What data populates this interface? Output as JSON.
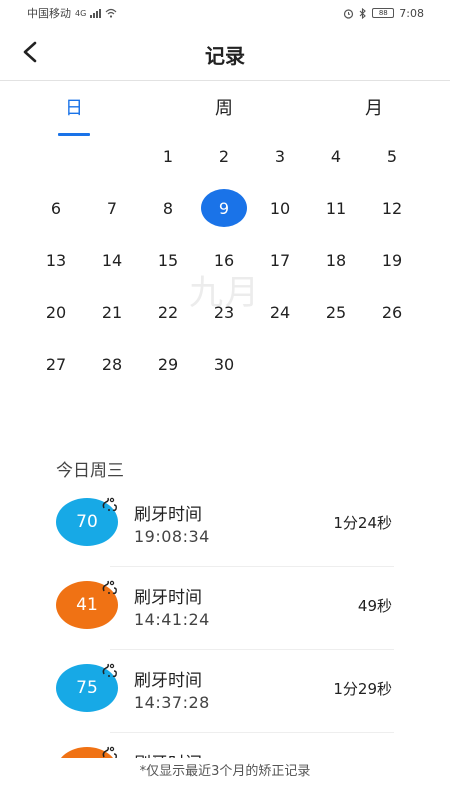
{
  "status_bar": {
    "carrier": "中国移动",
    "network": "4G",
    "battery": "88",
    "time": "7:08",
    "icons": [
      "signal-icon",
      "wifi-icon",
      "alarm-icon",
      "bluetooth-icon",
      "battery-icon"
    ]
  },
  "header": {
    "title": "记录",
    "back_icon": "chevron-left-icon"
  },
  "tabs": [
    {
      "label": "日",
      "active": true
    },
    {
      "label": "周",
      "active": false
    },
    {
      "label": "月",
      "active": false
    }
  ],
  "calendar": {
    "month_watermark": "九月",
    "leading_blanks": 2,
    "days": [
      "1",
      "2",
      "3",
      "4",
      "5",
      "6",
      "7",
      "8",
      "9",
      "10",
      "11",
      "12",
      "13",
      "14",
      "15",
      "16",
      "17",
      "18",
      "19",
      "20",
      "21",
      "22",
      "23",
      "24",
      "25",
      "26",
      "27",
      "28",
      "29",
      "30"
    ],
    "selected_day": "9",
    "selected_color": "#1a73e8"
  },
  "records": {
    "section_title": "今日周三",
    "items": [
      {
        "score": "70",
        "title": "刷牙时间",
        "time": "19:08:34",
        "duration": "1分24秒",
        "color": "#17a9e6"
      },
      {
        "score": "41",
        "title": "刷牙时间",
        "time": "14:41:24",
        "duration": "49秒",
        "color": "#f07214"
      },
      {
        "score": "75",
        "title": "刷牙时间",
        "time": "14:37:28",
        "duration": "1分29秒",
        "color": "#17a9e6"
      },
      {
        "score": "",
        "title": "刷牙时间",
        "time": "",
        "duration": "",
        "color": "#f07214"
      }
    ]
  },
  "footnote": "*仅显示最近3个月的矫正记录"
}
